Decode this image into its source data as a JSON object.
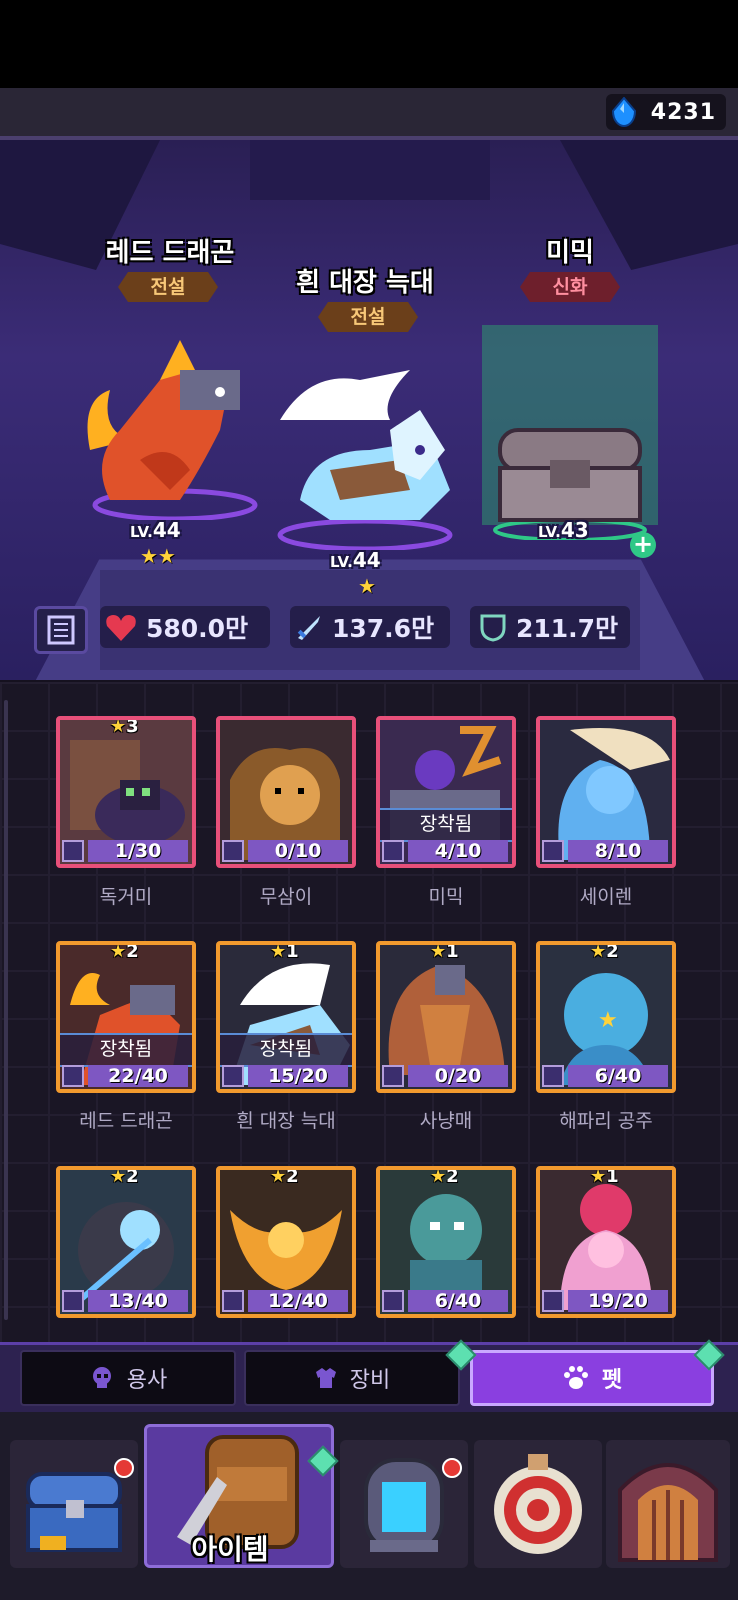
{
  "currency": {
    "icon": "blue-gem-icon",
    "amount": "4231"
  },
  "party": [
    {
      "name": "레드 드래곤",
      "grade": "전설",
      "level_prefix": "LV.",
      "level": "44",
      "stars": 2
    },
    {
      "name": "흰 대장 늑대",
      "grade": "전설",
      "level_prefix": "LV.",
      "level": "44",
      "stars": 1
    },
    {
      "name": "미믹",
      "grade": "신화",
      "level_prefix": "LV.",
      "level": "43",
      "stars": 0
    }
  ],
  "stats": {
    "hp": "580.0만",
    "attack": "137.6만",
    "defense": "211.7만"
  },
  "pets": [
    {
      "name": "독거미",
      "stars": "3",
      "count": "1/30",
      "grade": "myth",
      "equipped": false
    },
    {
      "name": "무삼이",
      "stars": "",
      "count": "0/10",
      "grade": "myth",
      "equipped": false
    },
    {
      "name": "미믹",
      "stars": "",
      "count": "4/10",
      "grade": "myth",
      "equipped": true
    },
    {
      "name": "세이렌",
      "stars": "",
      "count": "8/10",
      "grade": "myth",
      "equipped": false
    },
    {
      "name": "레드 드래곤",
      "stars": "2",
      "count": "22/40",
      "grade": "leg",
      "equipped": true
    },
    {
      "name": "흰 대장 늑대",
      "stars": "1",
      "count": "15/20",
      "grade": "leg",
      "equipped": true
    },
    {
      "name": "사냥매",
      "stars": "1",
      "count": "0/20",
      "grade": "leg",
      "equipped": false
    },
    {
      "name": "해파리 공주",
      "stars": "2",
      "count": "6/40",
      "grade": "leg",
      "equipped": false
    },
    {
      "name": "",
      "stars": "2",
      "count": "13/40",
      "grade": "leg",
      "equipped": false
    },
    {
      "name": "",
      "stars": "2",
      "count": "12/40",
      "grade": "leg",
      "equipped": false
    },
    {
      "name": "",
      "stars": "2",
      "count": "6/40",
      "grade": "leg",
      "equipped": false
    },
    {
      "name": "",
      "stars": "1",
      "count": "19/20",
      "grade": "leg",
      "equipped": false
    }
  ],
  "equipped_label": "장착됨",
  "tabs": [
    {
      "label": "용사",
      "icon": "skull-icon"
    },
    {
      "label": "장비",
      "icon": "armor-icon"
    },
    {
      "label": "펫",
      "icon": "paw-icon",
      "active": true
    }
  ],
  "nav": {
    "active_label": "아이템",
    "items": [
      "treasure-chest-icon",
      "backpack-icon",
      "portal-icon",
      "target-icon",
      "dungeon-door-icon"
    ]
  },
  "colors": {
    "myth_border": "#e8507a",
    "legend_border": "#f29a2e",
    "accent": "#8a3fe0"
  }
}
